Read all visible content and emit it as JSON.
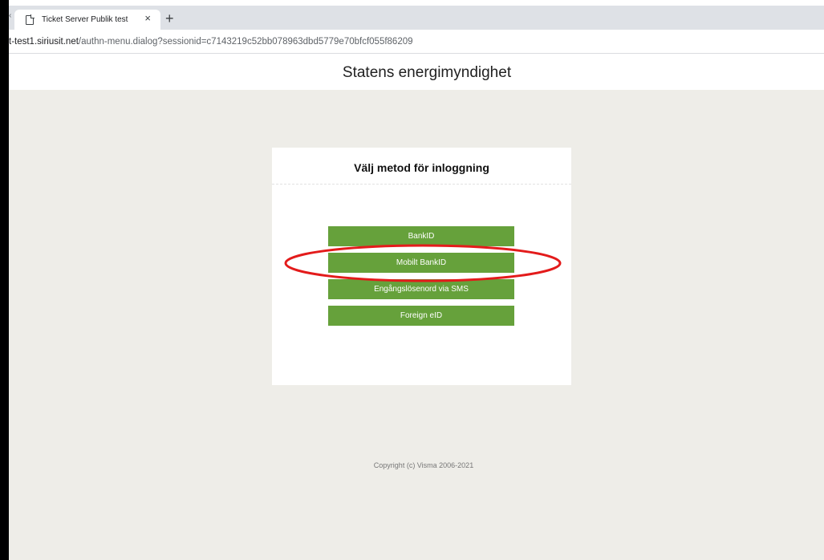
{
  "browser": {
    "tab_title": "Ticket Server Publik test",
    "tab_close": "×",
    "new_tab": "+",
    "url_host": "t-test1.siriusit.net",
    "url_rest": "/authn-menu.dialog?sessionid=c7143219c52bb078963dbd5779e70bfcf055f86209"
  },
  "header": {
    "title": "Statens energimyndighet"
  },
  "login": {
    "heading": "Välj metod för inloggning",
    "buttons": [
      {
        "label": "BankID"
      },
      {
        "label": "Mobilt BankID"
      },
      {
        "label": "Engångslösenord via SMS"
      },
      {
        "label": "Foreign eID"
      }
    ]
  },
  "footer": {
    "copyright": "Copyright (c) Visma 2006-2021"
  },
  "colors": {
    "button_green": "#66a13b",
    "page_background": "#eeede8",
    "annotation_red": "#e31b1b"
  },
  "annotation": {
    "shape": "ellipse",
    "highlights": "Mobilt BankID"
  }
}
